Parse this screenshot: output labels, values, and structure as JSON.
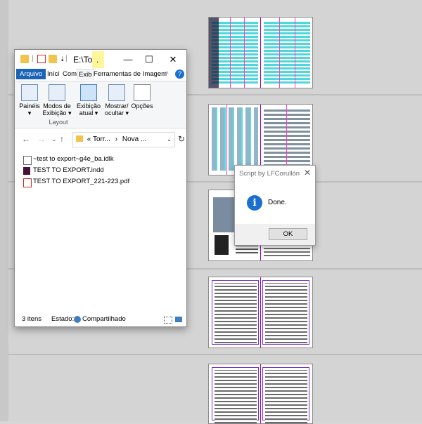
{
  "explorer": {
    "title": "E:\\To...",
    "title_suffix": ".",
    "tabs": [
      "Arquivo",
      "Iníci",
      "Com",
      "Exib",
      "Ferramentas de Imagem"
    ],
    "ribbon": {
      "buttons": [
        {
          "label": "Painéis",
          "label2": "▾"
        },
        {
          "label": "Modos de",
          "label2": "Exibição ▾"
        },
        {
          "label": "Exibição",
          "label2": "atual ▾"
        },
        {
          "label": "Mostrar/",
          "label2": "ocultar ▾"
        },
        {
          "label": "Opções",
          "label2": ""
        }
      ],
      "group_label": "Layout"
    },
    "address": {
      "prefix": "«",
      "part1": "Torr...",
      "sep": "›",
      "part2": "Nova ..."
    },
    "files": [
      {
        "name": "~test to export~g4e_ba.idlk",
        "icon": "lock-file-icon"
      },
      {
        "name": "TEST TO EXPORT.indd",
        "icon": "indesign-icon"
      },
      {
        "name": "TEST TO EXPORT_221-223.pdf",
        "icon": "pdf-icon"
      }
    ],
    "status": {
      "count": "3 itens",
      "state_label": "Estado:",
      "state_value": "Compartilhado"
    }
  },
  "dialog": {
    "title": "Script by LFCorullón",
    "message": "Done.",
    "ok_label": "OK"
  },
  "colors": {
    "file_tab": "#1a63b7",
    "info_icon": "#1a6fd1",
    "title_highlight": "#fff59a"
  }
}
